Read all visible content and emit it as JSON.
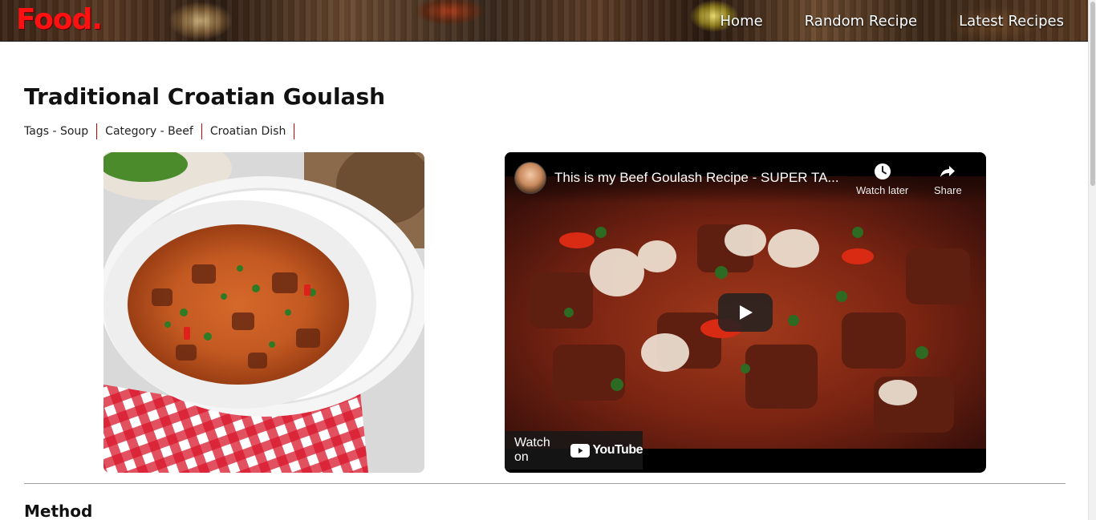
{
  "header": {
    "logo": "Food.",
    "nav": [
      {
        "label": "Home"
      },
      {
        "label": "Random Recipe"
      },
      {
        "label": "Latest Recipes"
      }
    ]
  },
  "recipe": {
    "title": "Traditional Croatian Goulash",
    "tags": [
      "Tags - Soup",
      "Category - Beef",
      "Croatian Dish"
    ],
    "image_alt": "Traditional Croatian Goulash in a white bowl",
    "method_heading": "Method"
  },
  "video": {
    "title": "This is my Beef Goulash Recipe - SUPER TA...",
    "watch_later": "Watch later",
    "share": "Share",
    "watch_on": "Watch on",
    "youtube": "YouTube"
  },
  "icons": {
    "watch_later": "clock-icon",
    "share": "share-arrow-icon",
    "play": "play-icon",
    "youtube": "youtube-logo-icon"
  },
  "colors": {
    "logo": "#ff1111",
    "tag_separator": "#c80000",
    "youtube_red": "#ff0000"
  }
}
